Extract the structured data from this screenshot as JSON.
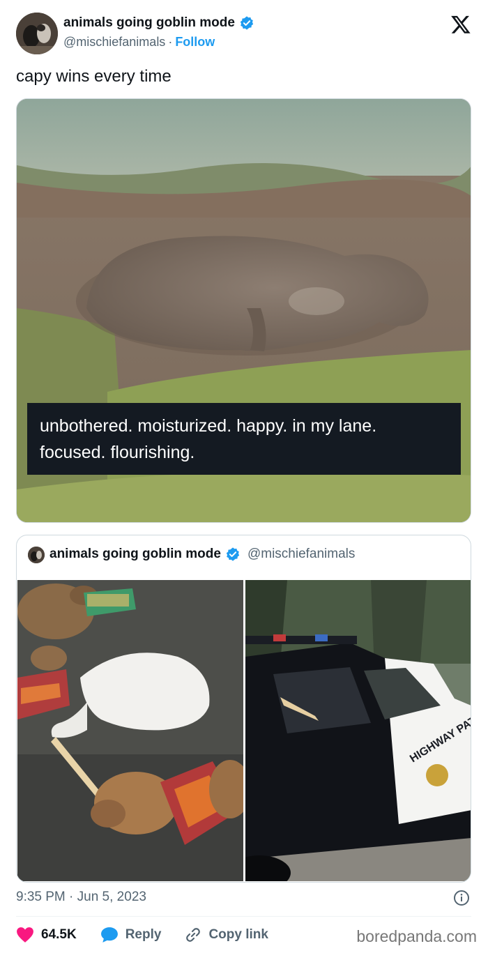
{
  "author": {
    "name": "animals going goblin mode",
    "handle": "@mischiefanimals",
    "follow_label": "Follow",
    "separator": "·"
  },
  "tweet": {
    "text": "capy wins every time"
  },
  "media": {
    "caption_lines": [
      "unbothered. moisturized. happy. in my lane.",
      "focused. flourishing."
    ]
  },
  "quote": {
    "name": "animals going goblin mode",
    "handle": "@mischiefanimals",
    "car_text": "HIGHWAY PATROL"
  },
  "footer": {
    "timestamp": "9:35 PM · Jun 5, 2023",
    "likes": "64.5K",
    "reply_label": "Reply",
    "copy_label": "Copy link",
    "watermark": "boredpanda.com"
  },
  "icons": {
    "brand": "x-logo-icon",
    "verified": "verified-badge-icon",
    "info": "info-icon",
    "like": "heart-icon",
    "reply": "reply-bubble-icon",
    "copy": "link-icon"
  },
  "colors": {
    "accent": "#1d9bf0",
    "like": "#f91880",
    "text": "#0f1419",
    "secondary": "#536471"
  }
}
